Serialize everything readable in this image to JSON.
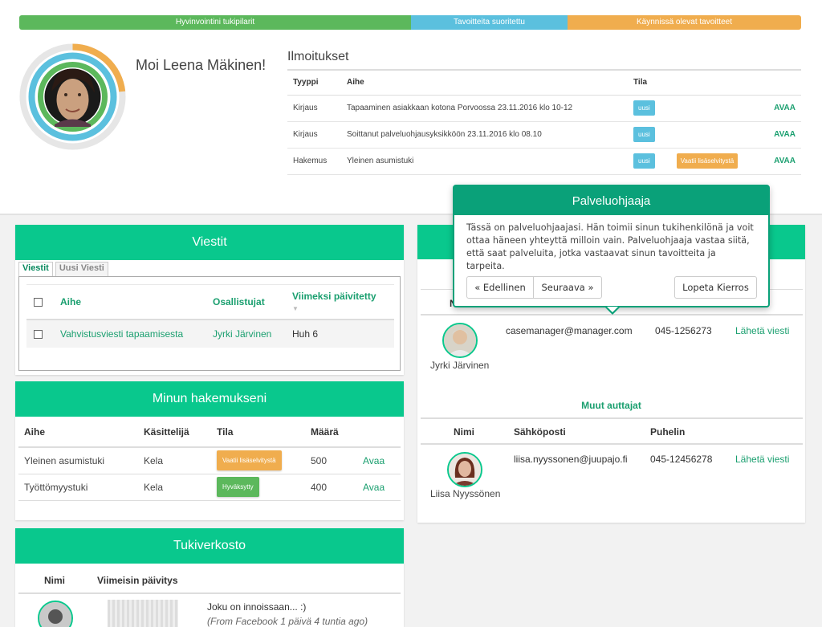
{
  "progress": {
    "pillars_label": "Hyvinvointini tukipilarit",
    "done_label": "Tavoitteita suoritettu",
    "ongoing_label": "Käynnissä olevat tavoitteet",
    "colors": {
      "pillars": "#5cb85c",
      "done": "#5bc0de",
      "ongoing": "#f0ad4e"
    }
  },
  "greeting": "Moi Leena Mäkinen!",
  "notifications": {
    "title": "Ilmoitukset",
    "headers": {
      "type": "Tyyppi",
      "subject": "Aihe",
      "status": "Tila"
    },
    "rows": [
      {
        "type": "Kirjaus",
        "subject": "Tapaaminen asiakkaan kotona Porvoossa 23.11.2016 klo 10-12",
        "badge": "uusi",
        "badge2": "",
        "action": "AVAA"
      },
      {
        "type": "Kirjaus",
        "subject": "Soittanut palveluohjausyksikköön 23.11.2016 klo 08.10",
        "badge": "uusi",
        "badge2": "",
        "action": "AVAA"
      },
      {
        "type": "Hakemus",
        "subject": "Yleinen asumistuki",
        "badge": "uusi",
        "badge2": "Vaatii lisäselvitystä",
        "action": "AVAA"
      }
    ]
  },
  "messages": {
    "title": "Viestit",
    "tab_active": "Viestit",
    "tab_inactive": "Uusi Viesti",
    "headers": {
      "subject": "Aihe",
      "participants": "Osallistujat",
      "updated": "Viimeksi päivitetty"
    },
    "rows": [
      {
        "subject": "Vahvistusviesti tapaamisesta",
        "participants": "Jyrki Järvinen",
        "updated": "Huh 6"
      }
    ]
  },
  "applications": {
    "title": "Minun hakemukseni",
    "headers": {
      "subject": "Aihe",
      "handler": "Käsittelijä",
      "status": "Tila",
      "amount": "Määrä"
    },
    "rows": [
      {
        "subject": "Yleinen asumistuki",
        "handler": "Kela",
        "status": "Vaatii lisäselvitystä",
        "amount": "500",
        "action": "Avaa"
      },
      {
        "subject": "Työttömyystuki",
        "handler": "Kela",
        "status": "Hyväksytty",
        "amount": "400",
        "action": "Avaa"
      }
    ]
  },
  "network": {
    "title": "Tukiverkosto",
    "headers": {
      "name": "Nimi",
      "latest": "Viimeisin päivitys"
    },
    "post_text": "Joku on innoissaan... :)",
    "post_meta": "(From Facebook 1 päivä 4 tuntia ago)"
  },
  "case_manager": {
    "name": "Jyrki Järvinen",
    "email": "casemanager@manager.com",
    "phone": "045-1256273",
    "action": "Lähetä viesti",
    "hidden_header_initial": "N"
  },
  "other_helpers": {
    "title": "Muut auttajat",
    "headers": {
      "name": "Nimi",
      "email": "Sähköposti",
      "phone": "Puhelin"
    },
    "name": "Liisa Nyyssönen",
    "email": "liisa.nyyssonen@juupajo.fi",
    "phone": "045-12456278",
    "action": "Lähetä viesti"
  },
  "tour": {
    "title": "Palveluohjaaja",
    "body": "Tässä on palveluohjaajasi. Hän toimii sinun tukihenkilönä ja voit ottaa häneen yhteyttä milloin vain. Palveluohjaaja vastaa siitä, että saat palveluita, jotka vastaavat sinun tavoitteita ja tarpeita.",
    "prev": "« Edellinen",
    "next": "Seuraava »",
    "end": "Lopeta Kierros"
  }
}
